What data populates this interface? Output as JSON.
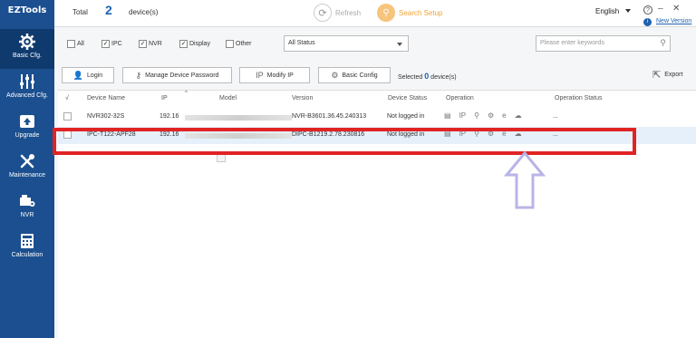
{
  "app": {
    "logo": "EZTools"
  },
  "sidebar": {
    "items": [
      {
        "label": "Basic Cfg.",
        "icon": "gear-icon"
      },
      {
        "label": "Advanced Cfg.",
        "icon": "sliders-icon"
      },
      {
        "label": "Upgrade",
        "icon": "upgrade-icon"
      },
      {
        "label": "Maintenance",
        "icon": "tools-icon"
      },
      {
        "label": "NVR",
        "icon": "nvr-icon"
      },
      {
        "label": "Calculation",
        "icon": "calculator-icon"
      }
    ]
  },
  "topbar": {
    "total_label": "Total",
    "total_count": "2",
    "devices_label": "device(s)",
    "refresh_label": "Refresh",
    "search_setup_label": "Search Setup",
    "language": "English",
    "new_version": "New Version"
  },
  "filters": {
    "checkboxes": [
      {
        "label": "All",
        "checked": false
      },
      {
        "label": "IPC",
        "checked": true
      },
      {
        "label": "NVR",
        "checked": true
      },
      {
        "label": "Display",
        "checked": true
      },
      {
        "label": "Other",
        "checked": false
      }
    ],
    "status_value": "All Status",
    "search_placeholder": "Please enter keywords"
  },
  "toolbar": {
    "login": "Login",
    "manage_password": "Manage Device Password",
    "modify_ip": "Modify IP",
    "basic_config": "Basic Config",
    "selected_label": "Selected",
    "selected_count": "0",
    "selected_suffix": "device(s)",
    "export": "Export"
  },
  "table": {
    "headers": {
      "check": "√",
      "device_name": "Device Name",
      "ip": "IP",
      "model": "Model",
      "version": "Version",
      "device_status": "Device Status",
      "operation": "Operation",
      "operation_status": "Operation Status"
    },
    "rows": [
      {
        "device_name": "NVR302-32S",
        "ip": "192.16",
        "version": "NVR-B3601.36.45.240313",
        "device_status": "Not logged in",
        "operation_status": "..."
      },
      {
        "device_name": "IPC-T122-APF28",
        "ip": "192.16",
        "version": "DIPC-B1219.2.78.230816",
        "device_status": "Not logged in",
        "operation_status": "..."
      }
    ],
    "operation_icons": [
      "document-icon",
      "ip-icon",
      "wrench-icon",
      "gear-icon",
      "browser-icon",
      "cloud-icon"
    ]
  },
  "colors": {
    "sidebar": "#1b4f8f",
    "accent": "#1e62b0",
    "highlight_box": "#e02424",
    "arrow": "#b9b4e6"
  }
}
